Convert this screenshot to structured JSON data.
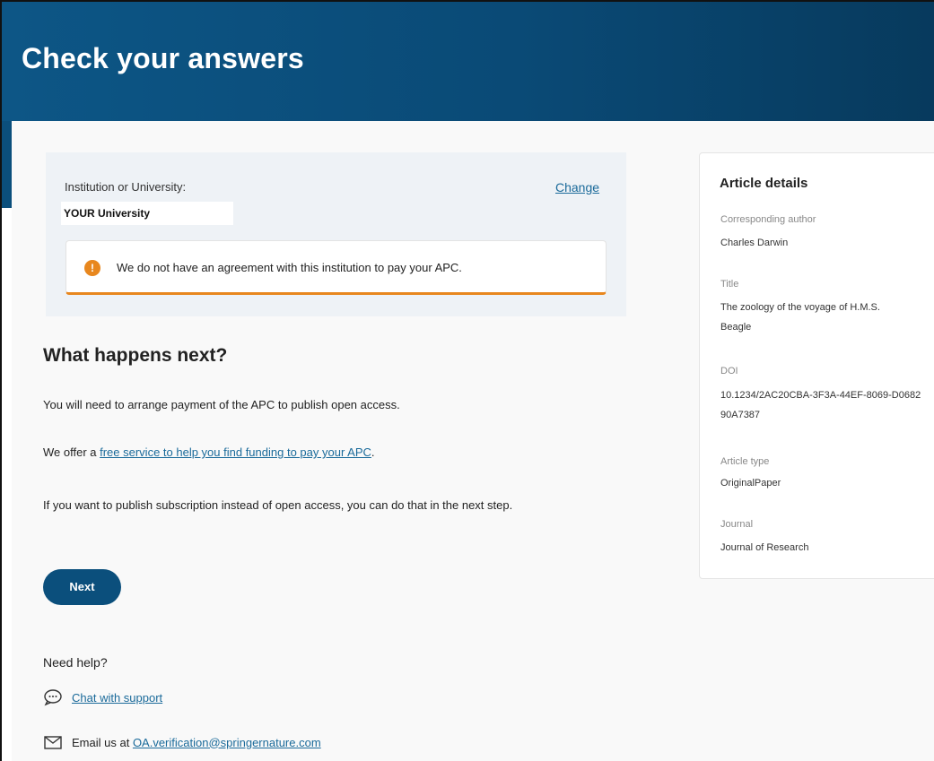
{
  "header": {
    "title": "Check your answers"
  },
  "institution": {
    "label": "Institution or University:",
    "change_label": "Change",
    "value": "YOUR University",
    "alert_text": "We do not have an agreement with this institution to pay your APC.",
    "alert_icon": "warning-icon",
    "alert_color": "#e8871e"
  },
  "next_steps": {
    "heading": "What happens next?",
    "p1": "You will need to arrange payment of the APC to publish open access.",
    "p2_prefix": "We offer a ",
    "p2_link": "free service to help you find funding to pay your APC",
    "p2_suffix": ".",
    "p3": "If you want to publish subscription instead of open access, you can do that in the next step.",
    "next_button": "Next"
  },
  "help": {
    "heading": "Need help?",
    "chat_link": "Chat with support",
    "email_prefix": "Email us at ",
    "email_link": "OA.verification@springernature.com"
  },
  "article_details": {
    "title": "Article details",
    "fields": [
      {
        "label": "Corresponding author",
        "value": "Charles Darwin"
      },
      {
        "label": "Title",
        "value": "The zoology of the voyage of H.M.S. Beagle"
      },
      {
        "label": "DOI",
        "value": "10.1234/2AC20CBA-3F3A-44EF-8069-D068290A7387"
      },
      {
        "label": "Article type",
        "value": "OriginalPaper"
      },
      {
        "label": "Journal",
        "value": "Journal of Research"
      }
    ]
  },
  "colors": {
    "primary": "#0b4f7c",
    "link": "#1a6a9a",
    "warning": "#e8871e"
  }
}
